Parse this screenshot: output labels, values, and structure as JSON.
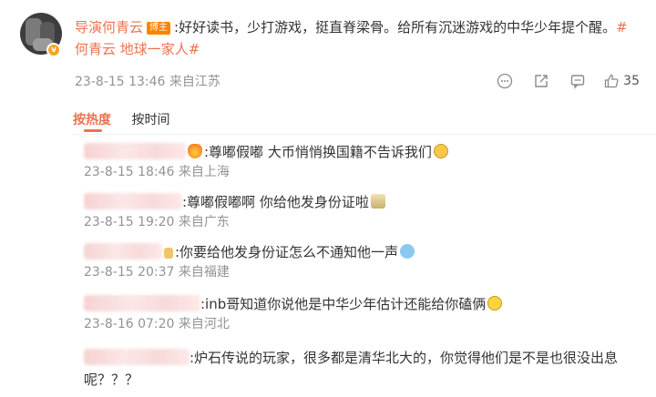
{
  "post": {
    "author": "导演何青云",
    "author_tag": "博主",
    "text": ":好好读书，少打游戏，挺直脊梁骨。给所有沉迷游戏的中华少年提个醒。",
    "hashtags": [
      "#何青云 地球一家人#"
    ],
    "time": "23-8-15 13:46",
    "location": "来自江苏",
    "like_count": "35",
    "action_icons": [
      "more-icon",
      "share-icon",
      "comment-icon",
      "like-icon"
    ]
  },
  "sort": {
    "by_hot": "按热度",
    "by_time": "按时间"
  },
  "comments": [
    {
      "text": ":尊嘟假嘟 大币悄悄换国籍不告诉我们",
      "time": "23-8-15 18:46",
      "location": "来自上海"
    },
    {
      "text": ":尊嘟假嘟啊 你给他发身份证啦",
      "time": "23-8-15 19:20",
      "location": "来自广东"
    },
    {
      "text": ":你要给他发身份证怎么不通知他一声",
      "time": "23-8-15 20:37",
      "location": "来自福建"
    },
    {
      "text": ":inb哥知道你说他是中华少年估计还能给你磕俩",
      "time": "23-8-16 07:20",
      "location": "来自河北"
    },
    {
      "text": ":炉石传说的玩家，很多都是清华北大的，你觉得他们是不是也很没出息呢？？？",
      "time": "",
      "location": ""
    }
  ],
  "colors": {
    "accent": "#eb7350",
    "meta": "#939393",
    "text": "#333333"
  }
}
